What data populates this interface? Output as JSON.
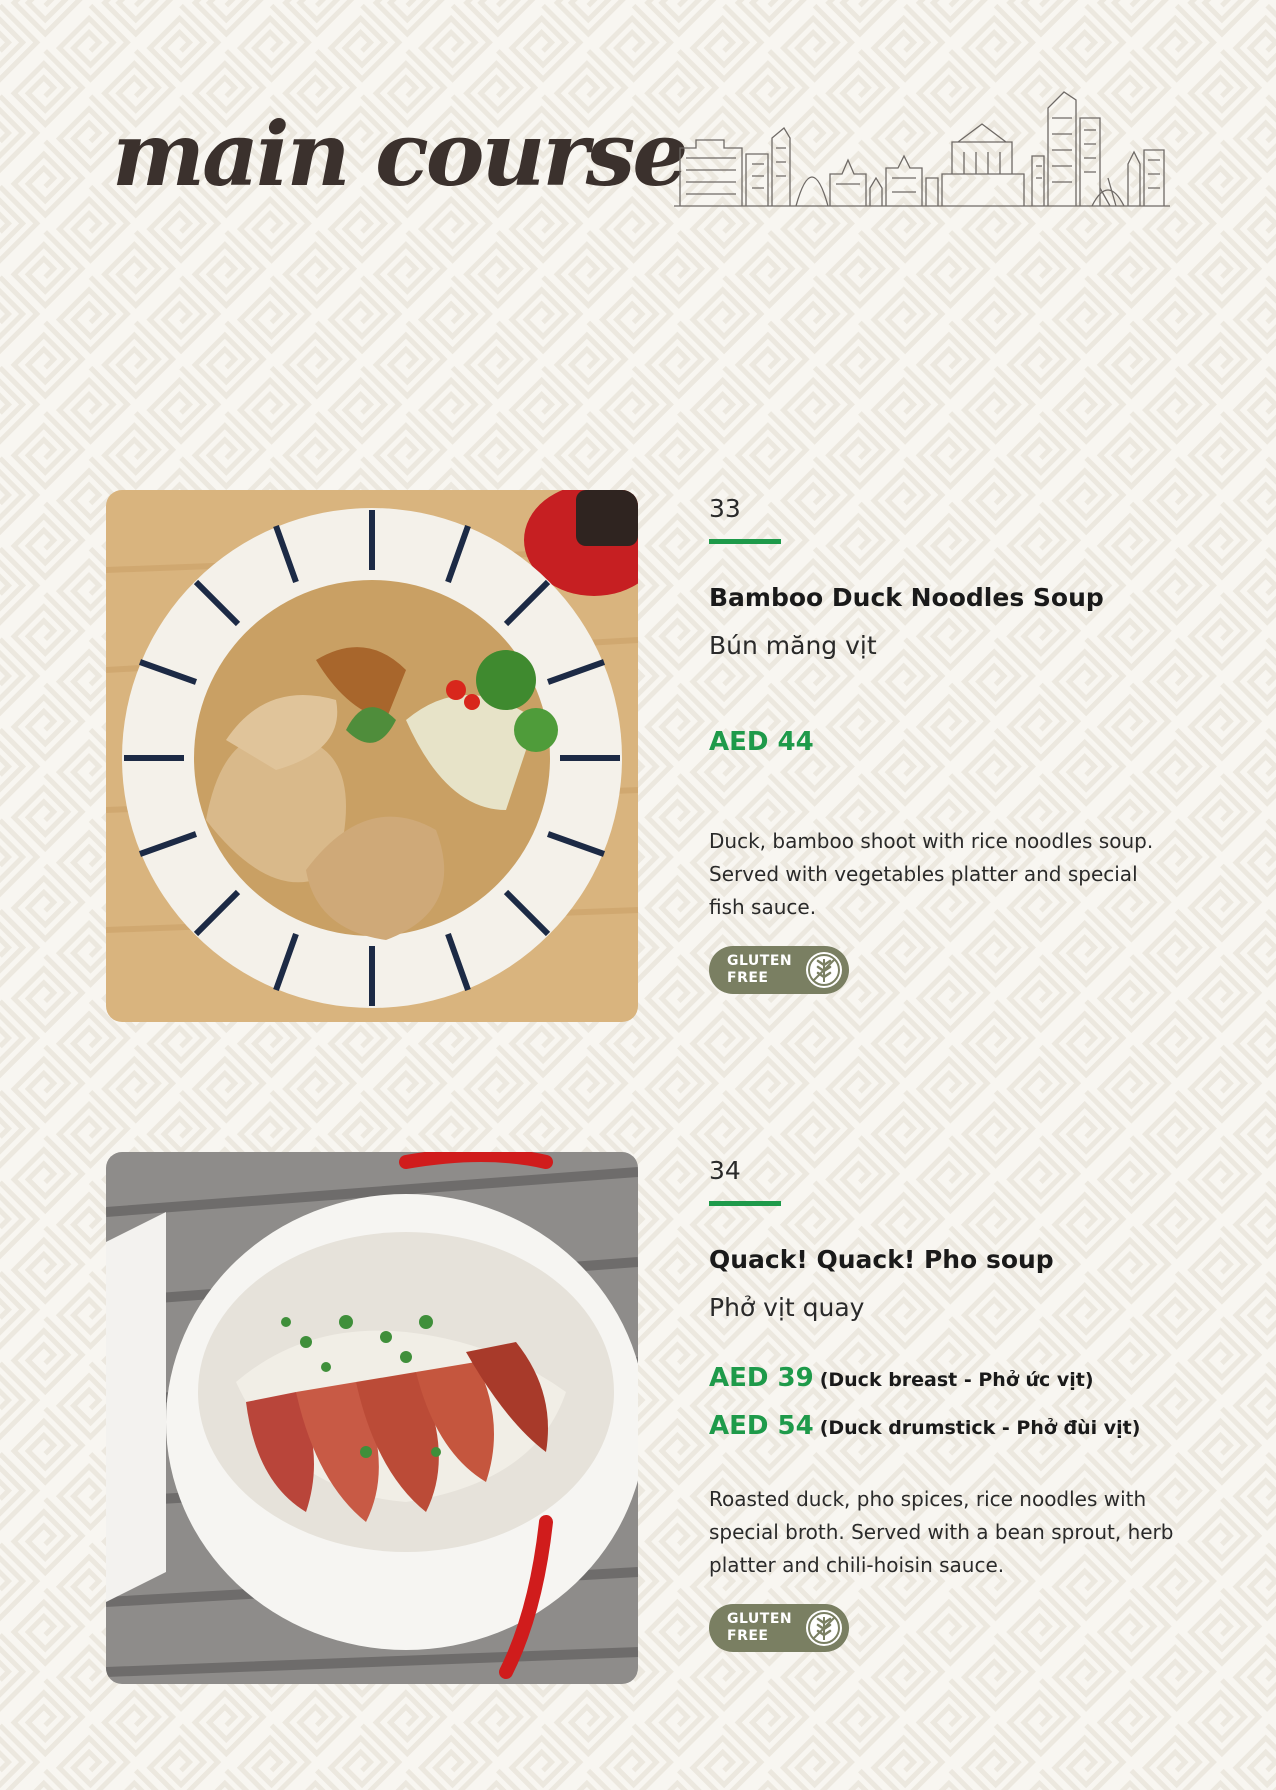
{
  "page": {
    "title": "main course"
  },
  "colors": {
    "accent": "#1e9a4a",
    "background": "#f8f6f1",
    "badge": "#7a7f62",
    "title": "#3b312d"
  },
  "dishes": [
    {
      "number": "33",
      "name": "Bamboo Duck Noodles Soup",
      "viet_name": "Bún măng vịt",
      "prices": [
        {
          "amount": "AED 44",
          "note": ""
        }
      ],
      "description": "Duck, bamboo shoot with rice noodles soup. Served with vegetables platter and special fish sauce.",
      "badge": {
        "line1": "GLUTEN",
        "line2": "FREE",
        "icon": "wheat-crossed-icon"
      },
      "photo": "duck-noodle-soup-striped-bowl"
    },
    {
      "number": "34",
      "name": "Quack! Quack! Pho soup",
      "viet_name": "Phở vịt quay",
      "prices": [
        {
          "amount": "AED 39",
          "note": "(Duck breast - Phở ức vịt)"
        },
        {
          "amount": "AED 54",
          "note": "(Duck drumstick - Phở đùi vịt)"
        }
      ],
      "description": "Roasted duck, pho spices, rice noodles with special broth. Served with a bean sprout, herb platter and chili-hoisin sauce.",
      "badge": {
        "line1": "GLUTEN",
        "line2": "FREE",
        "icon": "wheat-crossed-icon"
      },
      "photo": "roast-duck-pho-white-bowl"
    }
  ]
}
